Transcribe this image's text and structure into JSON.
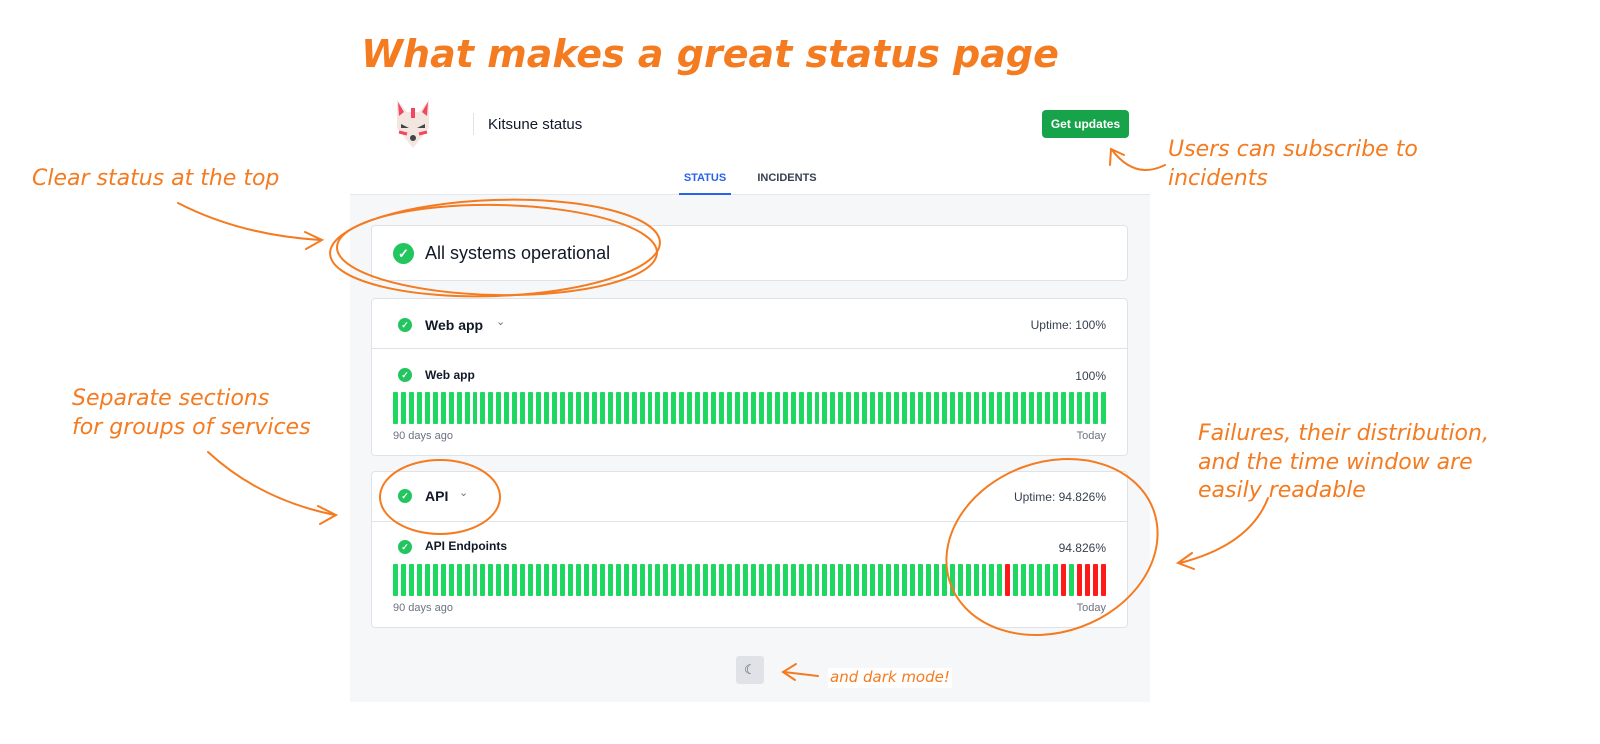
{
  "annotations": {
    "title": "What makes a great status page",
    "clear_status": "Clear status at the top",
    "subscribe": [
      "Users can subscribe to",
      "incidents"
    ],
    "sections": [
      "Separate sections",
      "for groups of services"
    ],
    "failures": [
      "Failures, their distribution,",
      "and the time window are",
      "easily readable"
    ],
    "dark_mode": "and dark mode!"
  },
  "header": {
    "brand": "Kitsune status",
    "get_updates": "Get updates",
    "logo_icon": "fox-mask-icon"
  },
  "tabs": [
    {
      "label": "STATUS",
      "active": true
    },
    {
      "label": "INCIDENTS",
      "active": false
    }
  ],
  "overall": {
    "label": "All systems operational",
    "icon": "check-circle-icon"
  },
  "groups": [
    {
      "name": "Web app",
      "uptime": "Uptime: 100%",
      "services": [
        {
          "name": "Web app",
          "uptime": "100%",
          "start": "90 days ago",
          "end": "Today",
          "days": 90,
          "failed_days_from_end": []
        }
      ]
    },
    {
      "name": "API",
      "uptime": "Uptime: 94.826%",
      "services": [
        {
          "name": "API Endpoints",
          "uptime": "94.826%",
          "start": "90 days ago",
          "end": "Today",
          "days": 90,
          "failed_days_from_end": [
            1,
            2,
            3,
            4,
            6,
            13
          ]
        }
      ]
    }
  ],
  "colors": {
    "accent": "#f47b20",
    "ok": "#22c55e",
    "bar_ok": "#1ed760",
    "bar_fail": "#ff1a1a",
    "button": "#16a34a",
    "tab_active": "#2563eb"
  },
  "dark_mode_icon": "moon-icon"
}
